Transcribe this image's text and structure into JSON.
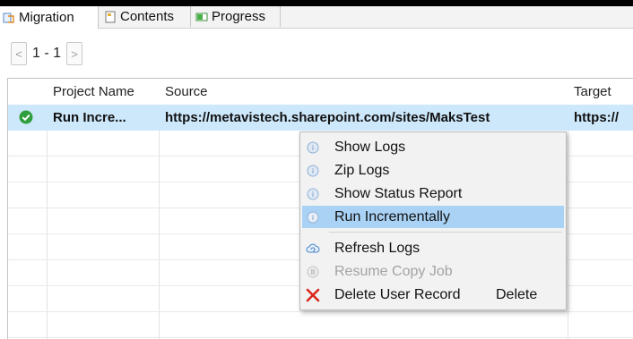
{
  "tabs": [
    {
      "label": "Migration",
      "icon": "migration-icon",
      "active": true
    },
    {
      "label": "Contents",
      "icon": "contents-icon",
      "active": false
    },
    {
      "label": "Progress",
      "icon": "progress-icon",
      "active": false
    }
  ],
  "pager": {
    "prev": "<",
    "label": "1 - 1",
    "next": ">"
  },
  "table": {
    "columns": [
      "",
      "Project Name",
      "Source",
      "Target"
    ],
    "rows": [
      {
        "status_icon": "check-circle-icon",
        "project_name": "Run Incre...",
        "source": "https://metavistech.sharepoint.com/sites/MaksTest",
        "target": "https://"
      }
    ]
  },
  "context_menu": {
    "items": [
      {
        "label": "Show Logs",
        "icon": "info-circle-icon",
        "state": "normal"
      },
      {
        "label": "Zip Logs",
        "icon": "info-circle-icon",
        "state": "normal"
      },
      {
        "label": "Show Status Report",
        "icon": "info-circle-icon",
        "state": "normal"
      },
      {
        "label": "Run Incrementally",
        "icon": "info-circle-icon",
        "state": "highlighted"
      },
      {
        "label": "Refresh Logs",
        "icon": "cloud-refresh-icon",
        "state": "normal"
      },
      {
        "label": "Resume Copy Job",
        "icon": "resume-icon",
        "state": "disabled"
      },
      {
        "label": "Delete User Record",
        "icon": "delete-x-icon",
        "state": "normal",
        "accelerator": "Delete"
      }
    ]
  },
  "colors": {
    "selection": "#cde8fb",
    "menu_highlight": "#a9d2f5",
    "success": "#2e9e3e",
    "delete": "#d9261c"
  }
}
